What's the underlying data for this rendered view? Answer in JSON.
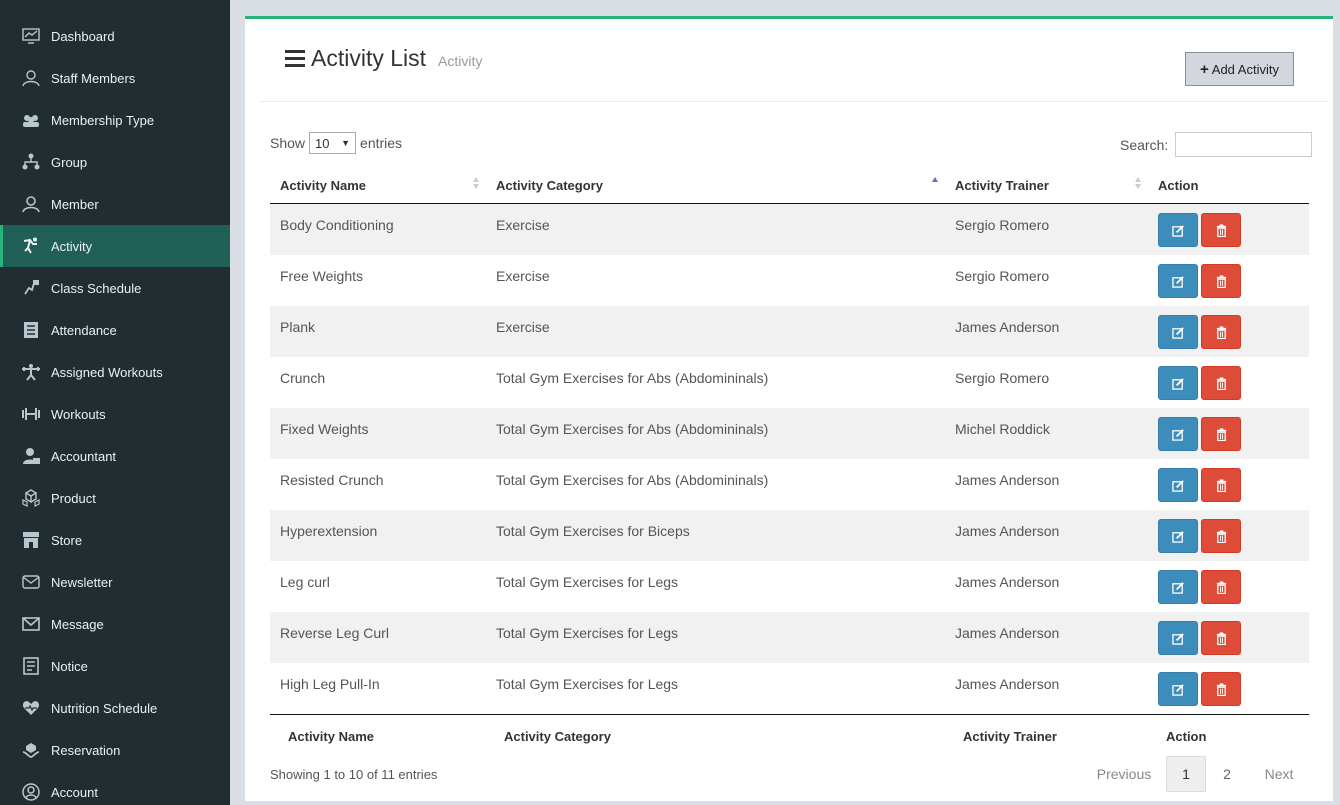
{
  "sidebar": {
    "items": [
      {
        "label": "Dashboard",
        "icon": "dashboard-icon"
      },
      {
        "label": "Staff Members",
        "icon": "staff-icon"
      },
      {
        "label": "Membership Type",
        "icon": "membership-icon"
      },
      {
        "label": "Group",
        "icon": "group-icon"
      },
      {
        "label": "Member",
        "icon": "member-icon"
      },
      {
        "label": "Activity",
        "icon": "activity-icon",
        "active": true
      },
      {
        "label": "Class Schedule",
        "icon": "class-schedule-icon"
      },
      {
        "label": "Attendance",
        "icon": "attendance-icon"
      },
      {
        "label": "Assigned Workouts",
        "icon": "assigned-workouts-icon"
      },
      {
        "label": "Workouts",
        "icon": "dumbbell-icon"
      },
      {
        "label": "Accountant",
        "icon": "accountant-icon"
      },
      {
        "label": "Product",
        "icon": "product-icon"
      },
      {
        "label": "Store",
        "icon": "store-icon"
      },
      {
        "label": "Newsletter",
        "icon": "newsletter-icon"
      },
      {
        "label": "Message",
        "icon": "message-icon"
      },
      {
        "label": "Notice",
        "icon": "notice-icon"
      },
      {
        "label": "Nutrition Schedule",
        "icon": "heart-icon"
      },
      {
        "label": "Reservation",
        "icon": "reservation-icon"
      },
      {
        "label": "Account",
        "icon": "account-icon"
      }
    ]
  },
  "header": {
    "title": "Activity List",
    "subtitle": "Activity",
    "add_button": "Add Activity"
  },
  "controls": {
    "show_label": "Show",
    "entries_value": "10",
    "entries_label": "entries",
    "search_label": "Search:",
    "search_value": ""
  },
  "table": {
    "headers": [
      "Activity Name",
      "Activity Category",
      "Activity Trainer",
      "Action"
    ],
    "rows": [
      [
        "Body Conditioning",
        "Exercise",
        "Sergio Romero"
      ],
      [
        "Free Weights",
        "Exercise",
        "Sergio Romero"
      ],
      [
        "Plank",
        "Exercise",
        "James Anderson"
      ],
      [
        "Crunch",
        "Total Gym Exercises for Abs (Abdomininals)",
        "Sergio Romero"
      ],
      [
        "Fixed Weights",
        "Total Gym Exercises for Abs (Abdomininals)",
        "Michel Roddick"
      ],
      [
        "Resisted Crunch",
        "Total Gym Exercises for Abs (Abdomininals)",
        "James Anderson"
      ],
      [
        "Hyperextension",
        "Total Gym Exercises for Biceps",
        "James Anderson"
      ],
      [
        "Leg curl",
        "Total Gym Exercises for Legs",
        "James Anderson"
      ],
      [
        "Reverse Leg Curl",
        "Total Gym Exercises for Legs",
        "James Anderson"
      ],
      [
        "High Leg Pull-In",
        "Total Gym Exercises for Legs",
        "James Anderson"
      ]
    ],
    "footer": [
      "Activity Name",
      "Activity Category",
      "Activity Trainer",
      "Action"
    ]
  },
  "pagination": {
    "info": "Showing 1 to 10 of 11 entries",
    "previous": "Previous",
    "pages": [
      "1",
      "2"
    ],
    "current": "1",
    "next": "Next"
  },
  "colors": {
    "sidebar_bg": "#222d32",
    "active_bg": "#1f5f55",
    "accent": "#2ab27b",
    "edit": "#3c8dbc",
    "delete": "#dd4b39"
  }
}
